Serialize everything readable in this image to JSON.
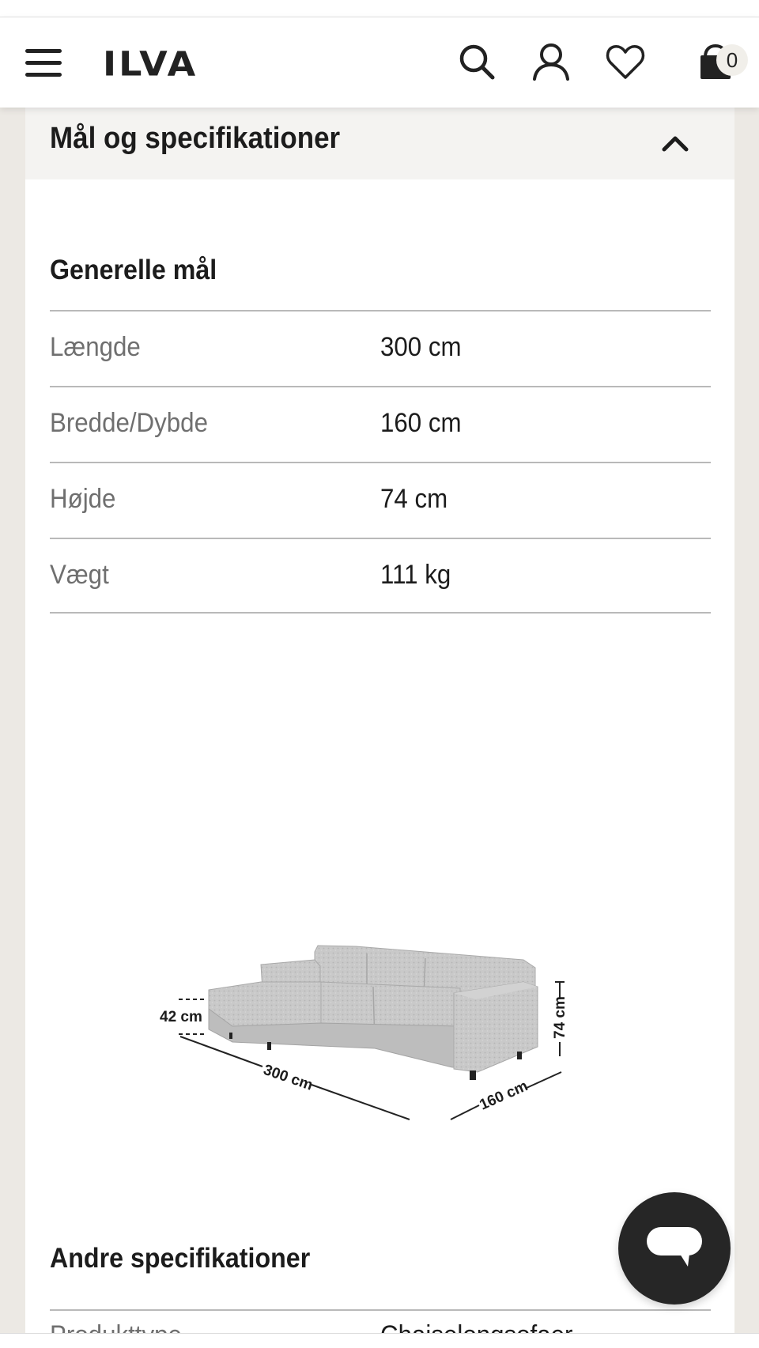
{
  "header": {
    "logo": "ILVA",
    "cart_count": "0",
    "icons": [
      "menu-icon",
      "search-icon",
      "user-icon",
      "heart-icon",
      "bag-icon"
    ]
  },
  "accordion": {
    "title": "Mål og specifikationer",
    "state": "expanded"
  },
  "general": {
    "title": "Generelle mål",
    "rows": [
      {
        "label": "Længde",
        "value": "300 cm"
      },
      {
        "label": "Bredde/Dybde",
        "value": "160 cm"
      },
      {
        "label": "Højde",
        "value": "74 cm"
      },
      {
        "label": "Vægt",
        "value": "111 kg"
      }
    ]
  },
  "diagram": {
    "seat_height": "42 cm",
    "length": "300 cm",
    "depth": "160 cm",
    "height": "74 cm"
  },
  "other": {
    "title": "Andre specifikationer",
    "rows": [
      {
        "label": "Produkttype",
        "value": "Chaiselongsofaer"
      }
    ]
  },
  "colors": {
    "background": "#ece9e4",
    "panel": "#ffffff",
    "accordion_header": "#f4f3f1",
    "label_text": "#6f6f6f",
    "chat_button": "#262626"
  }
}
